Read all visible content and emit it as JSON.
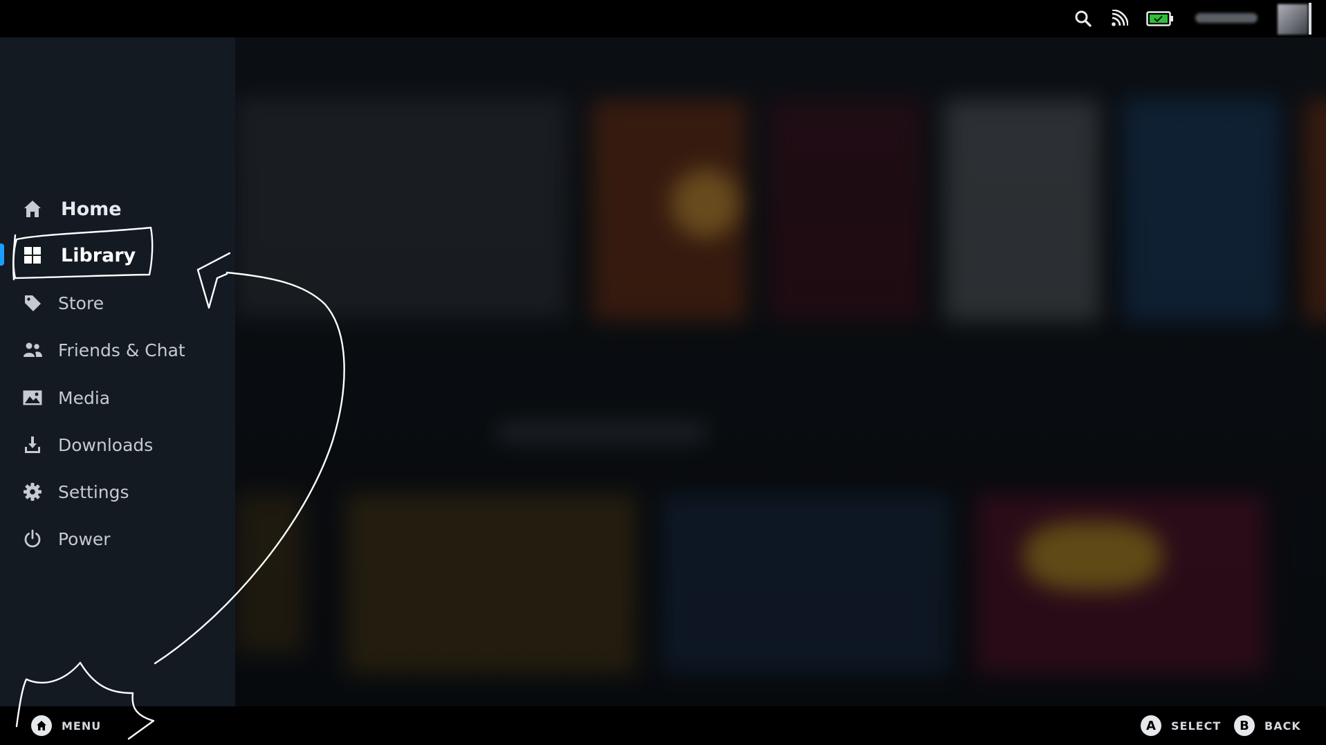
{
  "menu": {
    "items": [
      {
        "id": "home",
        "label": "Home",
        "icon": "home-icon"
      },
      {
        "id": "library",
        "label": "Library",
        "icon": "grid-icon",
        "active": true
      },
      {
        "id": "store",
        "label": "Store",
        "icon": "tag-icon"
      },
      {
        "id": "friends",
        "label": "Friends & Chat",
        "icon": "friends-icon"
      },
      {
        "id": "media",
        "label": "Media",
        "icon": "image-icon"
      },
      {
        "id": "downloads",
        "label": "Downloads",
        "icon": "download-icon"
      },
      {
        "id": "settings",
        "label": "Settings",
        "icon": "gear-icon"
      },
      {
        "id": "power",
        "label": "Power",
        "icon": "power-icon"
      }
    ]
  },
  "topbar": {
    "icons": [
      "search-icon",
      "cast-icon",
      "battery-icon"
    ],
    "battery_color": "#2fbf3a"
  },
  "bottombar": {
    "menu_hint": {
      "button_icon": "home-icon",
      "label": "MENU"
    },
    "select_hint": {
      "button": "A",
      "label": "SELECT"
    },
    "back_hint": {
      "button": "B",
      "label": "BACK"
    }
  },
  "colors": {
    "accent": "#1a9fff",
    "menu_bg": "#131a22",
    "bar_bg": "#000000"
  }
}
